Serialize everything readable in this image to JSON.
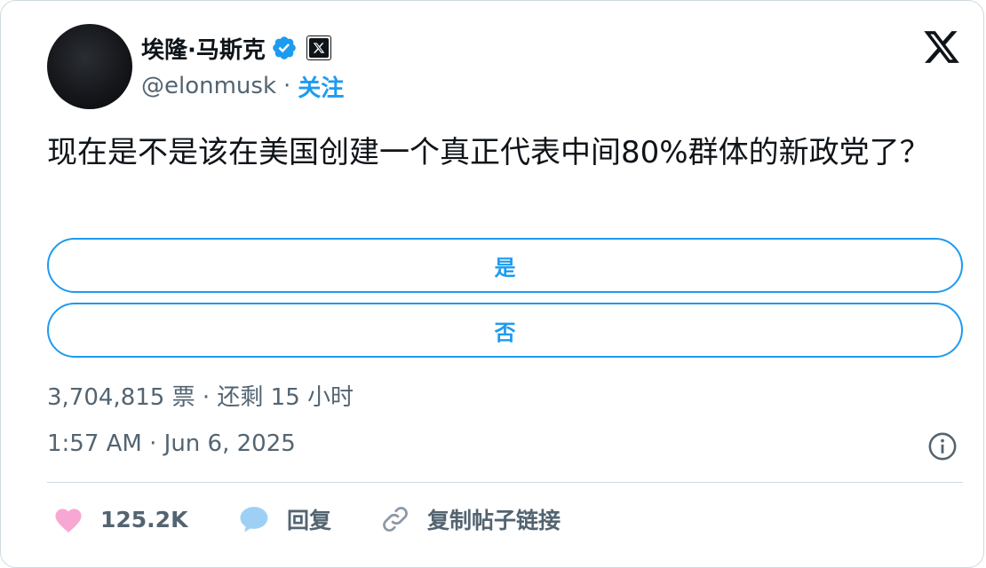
{
  "author": {
    "display_name": "埃隆·马斯克",
    "handle": "@elonmusk",
    "separator": "·",
    "follow_label": "关注"
  },
  "tweet": {
    "text": "现在是不是该在美国创建一个真正代表中间80%群体的新政党了？"
  },
  "poll": {
    "options": [
      {
        "label": "是"
      },
      {
        "label": "否"
      }
    ],
    "meta": "3,704,815 票 · 还剩 15 小时"
  },
  "timestamp": "1:57 AM · Jun 6, 2025",
  "actions": {
    "like_count": "125.2K",
    "reply_label": "回复",
    "copy_link_label": "复制帖子链接"
  },
  "colors": {
    "accent": "#1d9bf0",
    "like": "#f7a8d2",
    "text_secondary": "#536471"
  },
  "icons": [
    "verified-badge-icon",
    "x-affiliate-badge-icon",
    "x-logo-icon",
    "info-icon",
    "heart-icon",
    "reply-bubble-icon",
    "link-icon"
  ]
}
